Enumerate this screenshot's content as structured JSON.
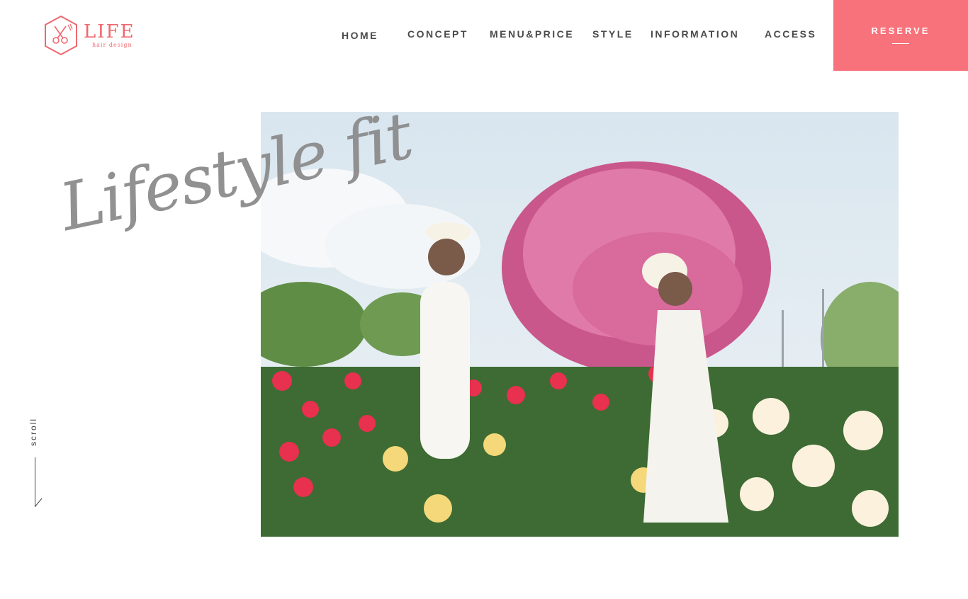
{
  "brand": {
    "name": "LIFE",
    "sub": "hair design",
    "color": "#f0676f",
    "icon": "scissors-icon"
  },
  "nav": {
    "items": [
      {
        "label": "HOME"
      },
      {
        "label": "CONCEPT"
      },
      {
        "label": "MENU&PRICE"
      },
      {
        "label": "STYLE"
      },
      {
        "label": "INFORMATION"
      },
      {
        "label": "ACCESS"
      }
    ],
    "reserve_label": "RESERVE",
    "reserve_color": "#f7727a"
  },
  "hero": {
    "tagline": "Lifestyle fit",
    "image_alt": "two women in white dresses among roses"
  },
  "scroll": {
    "label": "scroll"
  }
}
